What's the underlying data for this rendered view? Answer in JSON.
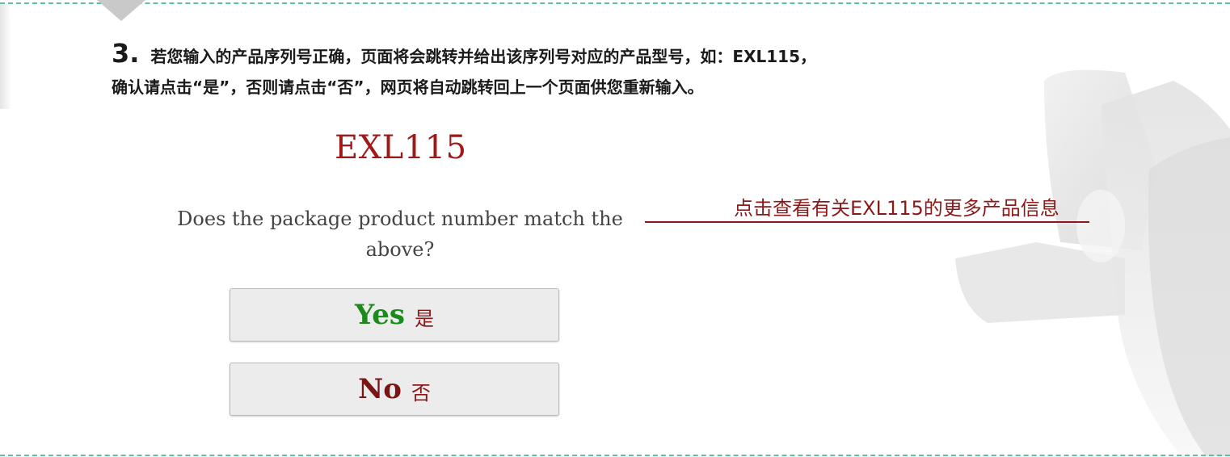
{
  "step": {
    "number": "3.",
    "line1": "若您输入的产品序列号正确，页面将会跳转并给出该序列号对应的产品型号，如：EXL115，",
    "line2": "确认请点击“是”，否则请点击“否”，网页将自动跳转回上一个页面供您重新输入。"
  },
  "model": "EXL115",
  "question": "Does the package product number match the above?",
  "callout": "点击查看有关EXL115的更多产品信息",
  "buttons": {
    "yes": {
      "en": "Yes",
      "zh": "是"
    },
    "no": {
      "en": "No",
      "zh": "否"
    }
  },
  "colors": {
    "divider": "#5fbfa9",
    "model": "#a01818",
    "callout": "#8a1a1a",
    "yes": "#1c8a1c",
    "no": "#7a1515"
  }
}
